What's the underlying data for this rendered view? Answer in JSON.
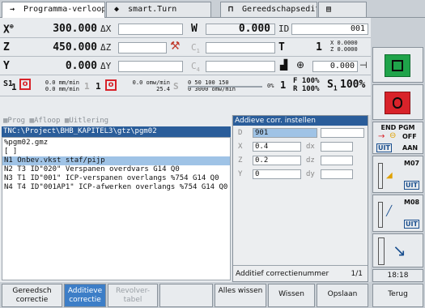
{
  "tabs": [
    {
      "label": "Programma-verloop",
      "icon": "→"
    },
    {
      "label": "smart.Turn",
      "icon": "◆"
    },
    {
      "label": "Gereedschapseditor",
      "icon": "⊓"
    },
    {
      "label": "",
      "icon": "▤"
    }
  ],
  "positions": {
    "x_label": "X",
    "x_sup": "⊕",
    "x_value": "300.000",
    "dx_label": "ΔX",
    "z_label": "Z",
    "z_value": "450.000",
    "dz_label": "ΔZ",
    "y_label": "Y",
    "y_value": "0.000",
    "dy_label": "ΔY",
    "w_label": "W",
    "w_value": "0.000",
    "id_label": "ID",
    "id_value": "001",
    "c1_label": "C",
    "c1_sub": "1",
    "c4_label": "C",
    "c4_sub": "4",
    "t_label": "T",
    "t_value": "1",
    "xz_x": "0.0000",
    "xz_z": "0.0000",
    "tool_value": "0.000"
  },
  "feedrow": {
    "s1": "S1",
    "s1_count": "1",
    "feed1_a": "0.0 mm/min",
    "feed1_b": "0.0 mm/min",
    "one_a": "1",
    "one_b": "1",
    "feed2_a": "0.0 omw/min",
    "feed2_b": "25.4",
    "scale": "0    50   100  150",
    "rpm": "0  3000 omw/min",
    "pct0": "0%",
    "one_c": "1",
    "f_pct": "F 100%",
    "r_pct": "R 100%",
    "s_label": "S",
    "s_sub": "1",
    "s_pct": "100%"
  },
  "program": {
    "toolbar": [
      "Prog",
      "Afloop",
      "Uitlering"
    ],
    "path": "TNC:\\Project\\BHB_KAPITEL3\\gtz\\pgm02",
    "lines": [
      "%pgm02.gmz",
      "[ ]",
      "N1 Onbev.vkst staf/pijp",
      "N2 T3 ID\"020\" Verspanen overdvars  G14 Q0",
      "N3 T1 ID\"001\" ICP-verspanen overlangs %754  G14 Q0",
      "N4 T4 ID\"001AP1\" ICP-afwerken overlangs %754  G14 Q0"
    ]
  },
  "dialog": {
    "title": "Addieve corr. instellen",
    "fields": [
      {
        "label": "D",
        "value": "901"
      },
      {
        "label": "X",
        "value": "0.4"
      },
      {
        "label": "Z",
        "value": "0.2"
      },
      {
        "label": "Y",
        "value": "0"
      }
    ],
    "dx_label": "dx",
    "dz_label": "dz",
    "dy_label": "dy",
    "status": "Additief correctienummer",
    "status_page": "1/1"
  },
  "right_softkeys": {
    "end_pgm": "END PGM",
    "off": "OFF",
    "uit1": "UIT",
    "aan": "AAN",
    "m07": "M07",
    "uit2": "UIT",
    "m08": "M08",
    "uit3": "UIT",
    "clock": "18:18"
  },
  "bottom_softkeys": [
    {
      "label": "Gereedsch correctie",
      "state": "normal"
    },
    {
      "label": "Additieve correctie",
      "state": "active"
    },
    {
      "label": "Revolver-tabel",
      "state": "disabled"
    },
    {
      "label": "",
      "state": "normal"
    },
    {
      "label": "Alles wissen",
      "state": "normal"
    },
    {
      "label": "Wissen",
      "state": "normal"
    },
    {
      "label": "Opslaan",
      "state": "normal"
    },
    {
      "label": "Terug",
      "state": "normal"
    }
  ],
  "colors": {
    "accent_blue": "#2a5d9a",
    "selection": "#9fc3e6",
    "softkey_active": "#3d7ec7",
    "spindle_red": "#d8232a",
    "machine_green": "#1fa34a"
  }
}
